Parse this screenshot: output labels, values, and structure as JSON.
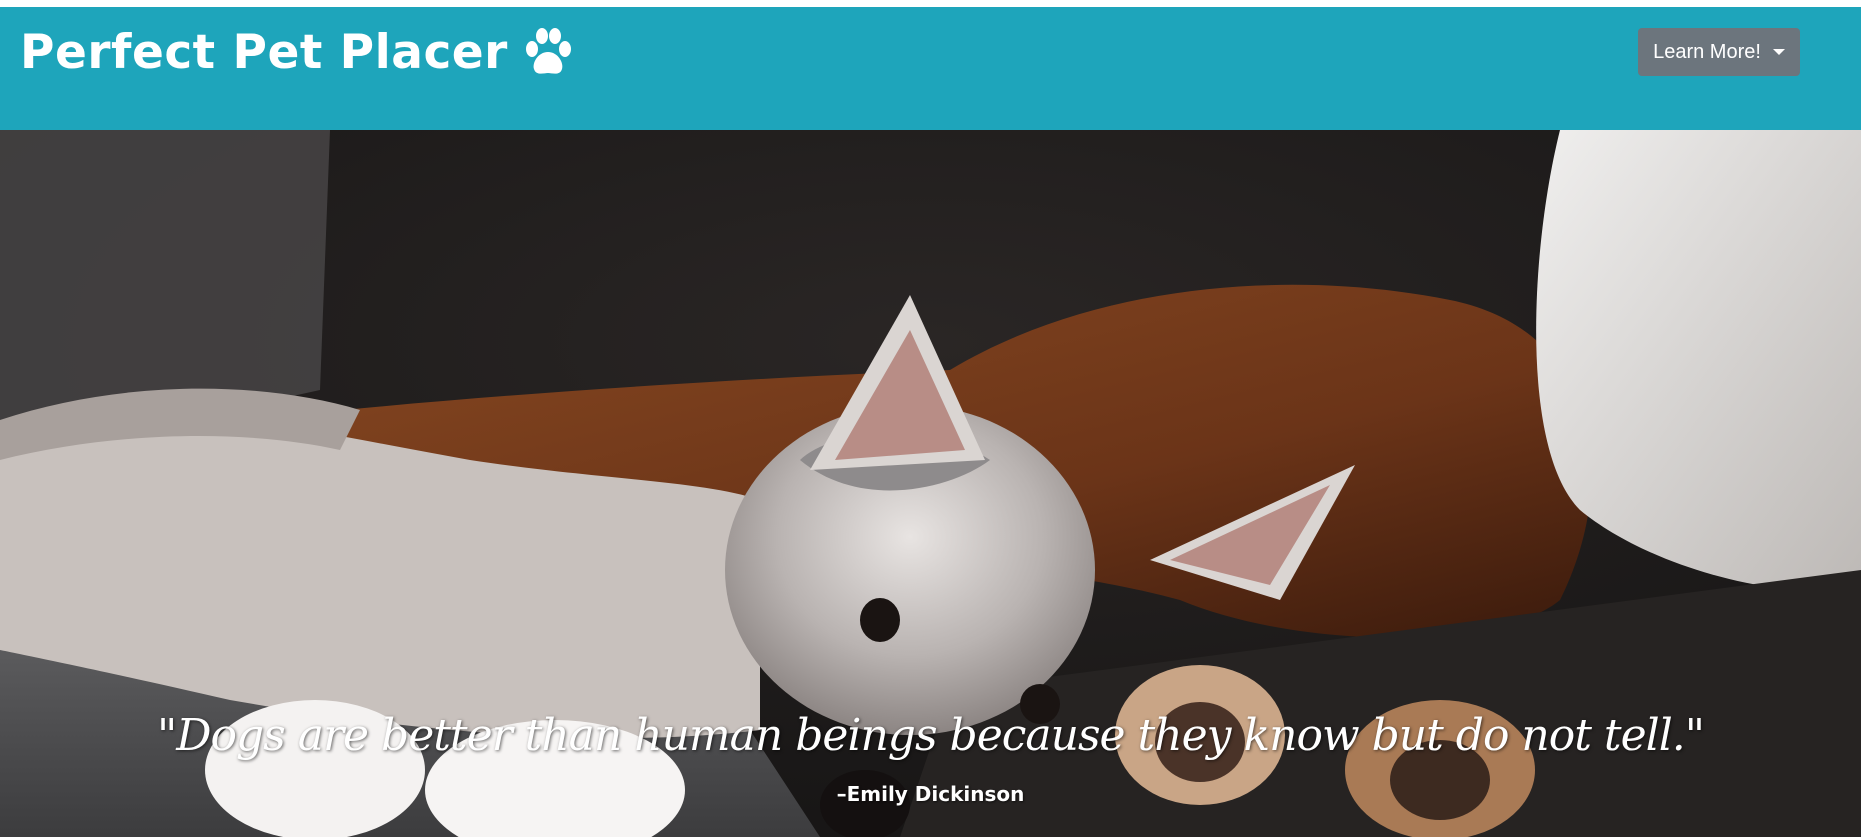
{
  "header": {
    "brand_title": "Perfect Pet Placer",
    "brand_icon": "paw-icon",
    "dropdown_label": "Learn More!",
    "dropdown_icon": "caret-down-icon",
    "background_color": "#1ea5bb",
    "button_color": "#6c757d"
  },
  "hero": {
    "image": "husky puppy and brown dog lying on a dark couch",
    "quote": "\"Dogs are better than human beings because they know but do not tell.\"",
    "author": "–Emily Dickinson"
  }
}
